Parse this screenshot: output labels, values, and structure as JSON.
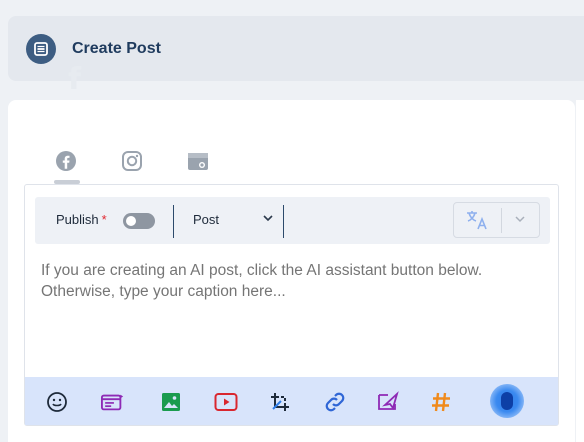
{
  "header": {
    "title": "Create Post",
    "icon": "post-icon"
  },
  "tabs": [
    {
      "name": "facebook",
      "icon": "facebook-icon",
      "active": true
    },
    {
      "name": "instagram",
      "icon": "instagram-icon",
      "active": false
    },
    {
      "name": "google-business",
      "icon": "store-icon",
      "active": false
    }
  ],
  "composer": {
    "publish_label": "Publish",
    "required_mark": "*",
    "publish_enabled": false,
    "post_type": "Post",
    "caption_placeholder": "If you are creating an AI post, click the AI assistant button below. Otherwise, type your caption here...",
    "caption_value": ""
  },
  "toolbar": {
    "icons": [
      "emoji-icon",
      "template-icon",
      "image-icon",
      "video-icon",
      "crop-icon",
      "link-icon",
      "send-icon",
      "hashtag-icon",
      "ai-assistant-icon"
    ]
  },
  "colors": {
    "brand": "#1f3b5e",
    "accent": "#2f7de9",
    "toolbar_bg": "#d8e4fb",
    "required": "#e0262e"
  }
}
